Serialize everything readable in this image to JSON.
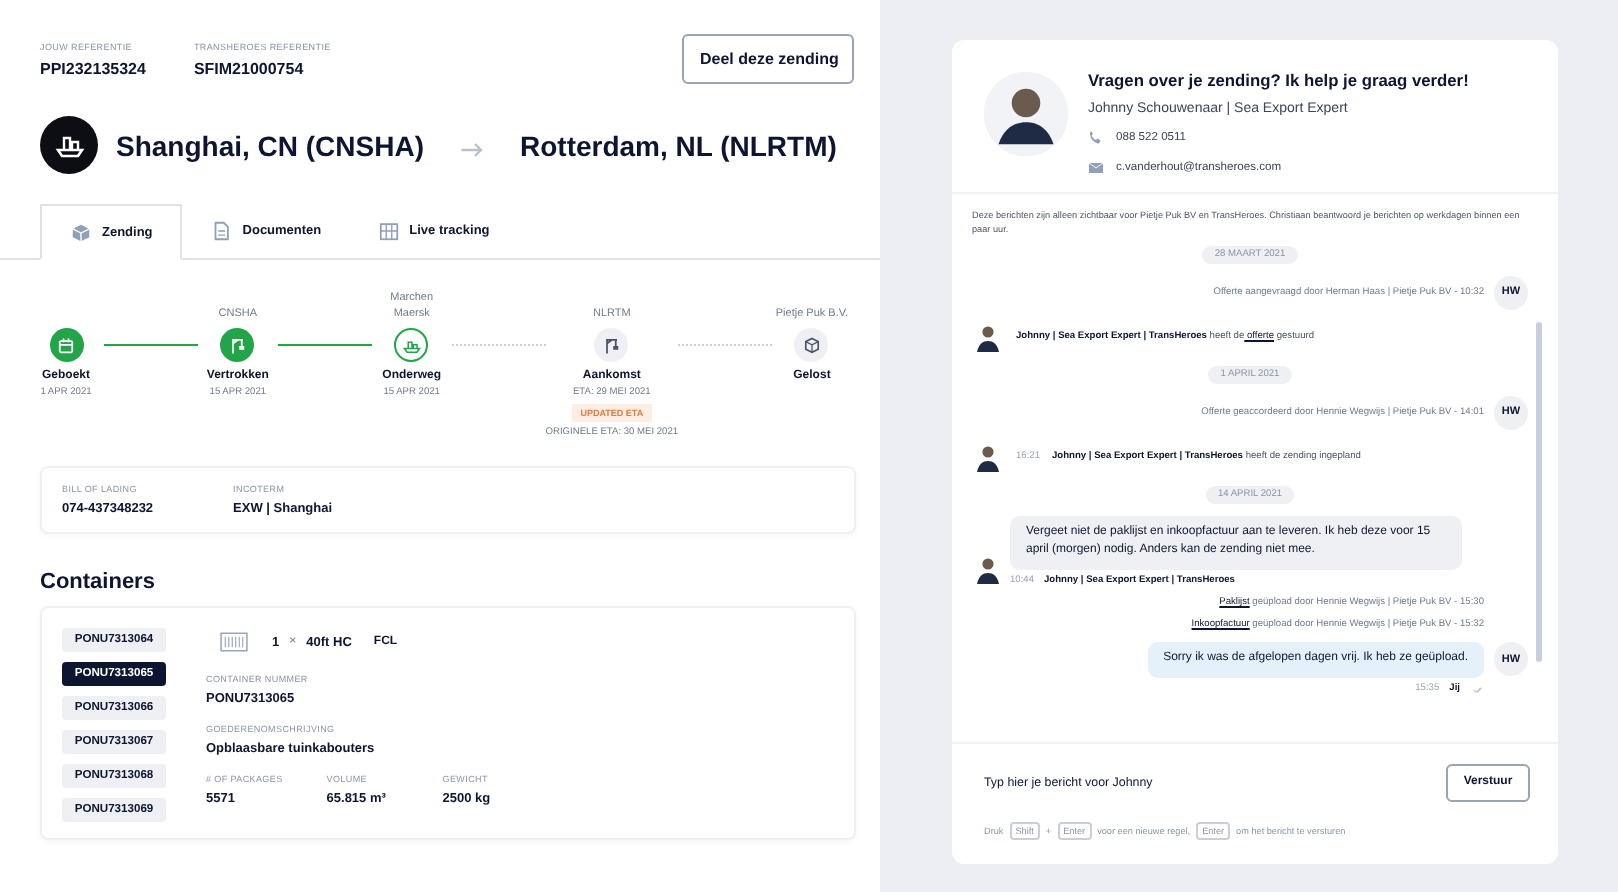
{
  "references": [
    {
      "label": "JOUW REFERENTIE",
      "value": "PPI232135324"
    },
    {
      "label": "TRANSHEROES REFERENTIE",
      "value": "SFIM21000754"
    }
  ],
  "share_button": "Deel deze zending",
  "route": {
    "origin": "Shanghai, CN (CNSHA)",
    "destination": "Rotterdam, NL (NLRTM)"
  },
  "tabs": [
    {
      "label": "Zending",
      "selected": true,
      "kind": "box"
    },
    {
      "label": "Documenten",
      "selected": false,
      "kind": "document"
    },
    {
      "label": "Live tracking",
      "selected": false,
      "kind": "map"
    }
  ],
  "timeline": [
    {
      "label": "Geboekt",
      "date": "1 APR 2021",
      "done": true,
      "current": false,
      "kind": "calendar"
    },
    {
      "top": "CNSHA",
      "label": "Vertrokken",
      "date": "15 APR 2021",
      "done": true,
      "current": false,
      "kind": "crane"
    },
    {
      "top": "Marchen Maersk",
      "label": "Onderweg",
      "date": "15 APR 2021",
      "done": false,
      "current": true,
      "kind": "ship"
    },
    {
      "top": "NLRTM",
      "label": "Aankomst",
      "date": "ETA: 29 MEI 2021",
      "badge": "UPDATED ETA",
      "original_eta": "ORIGINELE ETA: 30 MEI 2021",
      "done": false,
      "current": false,
      "kind": "crane"
    },
    {
      "top": "Pietje Puk B.V.",
      "label": "Gelost",
      "done": false,
      "current": false,
      "kind": "package"
    }
  ],
  "bill": [
    {
      "label": "BILL OF LADING",
      "value": "074-437348232"
    },
    {
      "label": "INCOTERM",
      "value": "EXW | Shanghai"
    }
  ],
  "containers": {
    "title": "Containers",
    "items": [
      {
        "label": "PONU7313064",
        "selected": false
      },
      {
        "label": "PONU7313065",
        "selected": true
      },
      {
        "label": "PONU7313066",
        "selected": false
      },
      {
        "label": "PONU7313067",
        "selected": false
      },
      {
        "label": "PONU7313068",
        "selected": false
      },
      {
        "label": "PONU7313069",
        "selected": false
      }
    ],
    "count": "1",
    "multiply": "×",
    "type": "40ft HC",
    "load": "FCL",
    "fields": [
      {
        "label": "CONTAINER NUMMER",
        "value": "PONU7313065"
      },
      {
        "label": "GOEDERENOMSCHRIJVING",
        "value": "Opblaasbare tuinkabouters"
      }
    ],
    "metrics": [
      {
        "label": "# OF PACKAGES",
        "value": "5571"
      },
      {
        "label": "VOLUME",
        "value": "65.815 m³"
      },
      {
        "label": "GEWICHT",
        "value": "2500 kg"
      }
    ]
  },
  "contact": {
    "title": "Vragen over je zending? Ik help je graag verder!",
    "name": "Johnny Schouwenaar | Sea Export Expert",
    "phone": "088 522 0511",
    "email": "c.vanderhout@transheroes.com"
  },
  "notice": "Deze berichten zijn alleen zichtbaar voor Pietje Puk BV en TransHeroes. Christiaan beantwoord je berichten op werkdagen binnen een paar uur.",
  "messages": [
    {
      "kind": "date",
      "text": "28 MAART 2021"
    },
    {
      "kind": "event_right",
      "avatar": "HW",
      "text": "Offerte aangevraagd door Herman Haas | Pietje Puk BV - 10:32"
    },
    {
      "kind": "event_left",
      "sender": "Johnny | Sea Export Expert | TransHeroes",
      "text": "heeft de",
      "link": "offerte",
      "after": "gestuurd"
    },
    {
      "kind": "date",
      "text": "1 APRIL 2021"
    },
    {
      "kind": "event_right",
      "avatar": "HW",
      "text": "Offerte geaccordeerd door Hennie Wegwijs | Pietje Puk BV - 14:01"
    },
    {
      "kind": "event_left",
      "time": "16:21",
      "sender": "Johnny | Sea Export Expert | TransHeroes",
      "text": "heeft de zending ingepland"
    },
    {
      "kind": "date",
      "text": "14 APRIL 2021"
    },
    {
      "kind": "bubble_left",
      "text": "Vergeet niet de paklijst en inkoopfactuur aan te leveren. Ik heb deze voor 15 april (morgen) nodig. Anders kan de zending niet mee.",
      "time": "10:44",
      "sender": "Johnny | Sea Export Expert | TransHeroes"
    },
    {
      "kind": "upload",
      "link": "Paklijst",
      "text": "geüpload door Hennie Wegwijs | Pietje Puk BV - 15:30"
    },
    {
      "kind": "upload",
      "link": "Inkoopfactuur",
      "text": "geüpload door Hennie Wegwijs | Pietje Puk BV - 15:32"
    },
    {
      "kind": "bubble_right",
      "avatar": "HW",
      "text": "Sorry ik was de afgelopen dagen vrij. Ik heb ze geüpload.",
      "time": "15:35",
      "sender": "Jij"
    }
  ],
  "composer": {
    "placeholder": "Typ hier je bericht voor Johnny",
    "send": "Verstuur",
    "hint": [
      {
        "text": "Druk",
        "key": false
      },
      {
        "text": "Shift",
        "key": true
      },
      {
        "text": "+",
        "key": false
      },
      {
        "text": "Enter",
        "key": true
      },
      {
        "text": "voor een nieuwe regel,",
        "key": false
      },
      {
        "text": "Enter",
        "key": true
      },
      {
        "text": "om het bericht te versturen",
        "key": false
      }
    ]
  }
}
